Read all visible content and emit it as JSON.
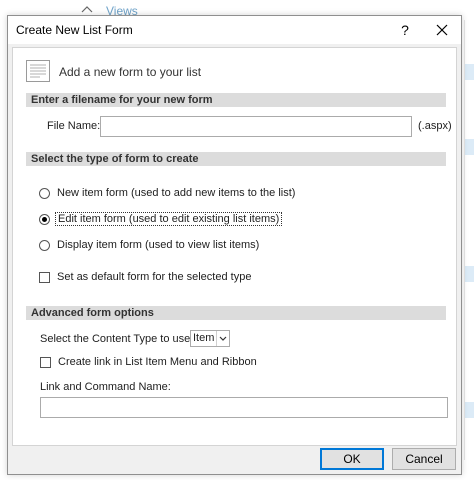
{
  "background": {
    "link_text": "Views"
  },
  "dialog": {
    "title": "Create New List Form",
    "help_glyph": "?",
    "header_text": "Add a new form to your list",
    "header_icon": "form-icon"
  },
  "filename_section": {
    "heading": "Enter a filename for your new form",
    "label": "File Name:",
    "value": "",
    "suffix": "(.aspx)"
  },
  "type_section": {
    "heading": "Select the type of form to create",
    "options": [
      {
        "label": "New item form (used to add new items to the list)",
        "selected": false
      },
      {
        "label": "Edit item form (used to edit existing list items)",
        "selected": true
      },
      {
        "label": "Display item form (used to view list items)",
        "selected": false
      }
    ],
    "default_checkbox": {
      "label": "Set as default form for the selected type",
      "checked": false
    }
  },
  "advanced_section": {
    "heading": "Advanced form options",
    "content_type_label": "Select the Content Type to use:",
    "content_type_value": "Item",
    "create_link_checkbox": {
      "label": "Create link in List Item Menu and Ribbon",
      "checked": false
    },
    "link_name_label": "Link and Command Name:",
    "link_name_value": ""
  },
  "buttons": {
    "ok": "OK",
    "cancel": "Cancel"
  },
  "colors": {
    "accent": "#0078d7",
    "section_bar": "#dcdcdc",
    "dialog_bg": "#f0f0f0"
  }
}
